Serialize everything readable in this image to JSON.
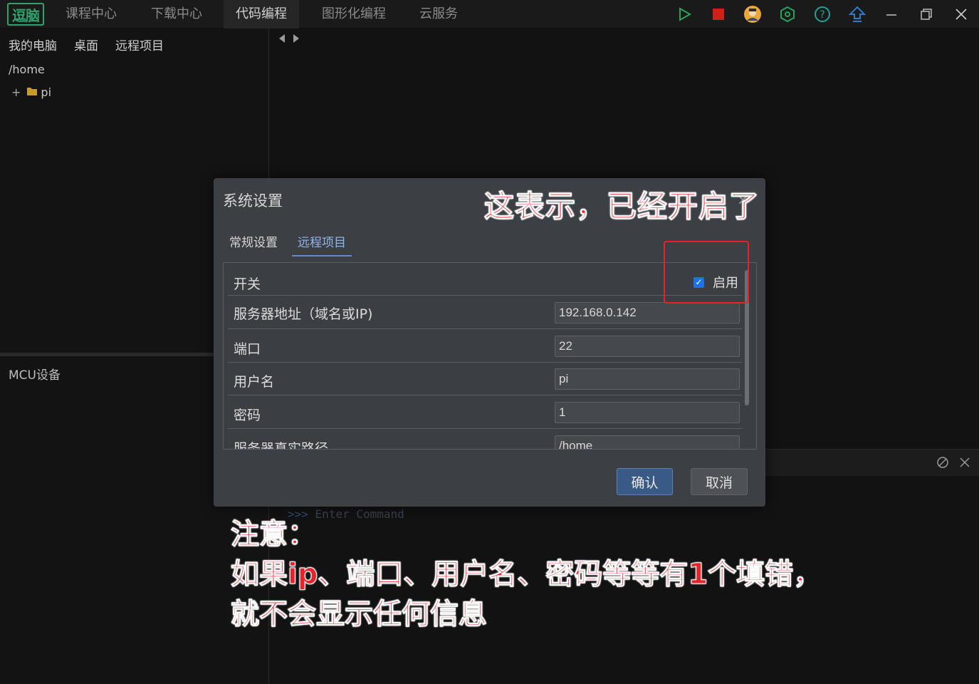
{
  "app": {
    "logo_text": "逗脑",
    "nav_tabs": [
      "课程中心",
      "下载中心",
      "代码编程",
      "图形化编程",
      "云服务"
    ],
    "active_tab": "代码编程",
    "toolbar_icons": [
      "play-icon",
      "stop-icon",
      "avatar-icon",
      "hexagon-settings-icon",
      "help-icon",
      "upload-icon",
      "minimize-icon",
      "restore-icon",
      "close-icon"
    ],
    "accent_colors": {
      "play": "#27a35a",
      "stop": "#d0201a",
      "help": "#1aa598",
      "upload": "#2f7ac8"
    }
  },
  "left": {
    "location_tabs": [
      "我的电脑",
      "桌面",
      "远程项目"
    ],
    "path": "/home",
    "tree": [
      {
        "expand": "+",
        "name": "pi"
      }
    ],
    "mcu_label": "MCU设备"
  },
  "console": {
    "prompt_symbol": ">>>",
    "placeholder": "Enter Command"
  },
  "dialog": {
    "title": "系统设置",
    "close": "×",
    "tabs": [
      "常规设置",
      "远程项目"
    ],
    "active_tab": "远程项目",
    "rows": {
      "switch_label": "开关",
      "enable_label": "启用",
      "enabled": true,
      "server_label": "服务器地址（域名或IP)",
      "server_value": "192.168.0.142",
      "port_label": "端口",
      "port_value": "22",
      "user_label": "用户名",
      "user_value": "pi",
      "password_label": "密码",
      "password_value": "1",
      "path_label": "服务器真实路径",
      "path_value": "/home"
    },
    "ok_label": "确认",
    "cancel_label": "取消"
  },
  "annotations": {
    "title": "这表示，已经开启了",
    "note_lines": [
      "注意：",
      "如果ip、端口、用户名、密码等等有1个填错，",
      "就不会显示任何信息"
    ],
    "color": "#e8222a"
  }
}
